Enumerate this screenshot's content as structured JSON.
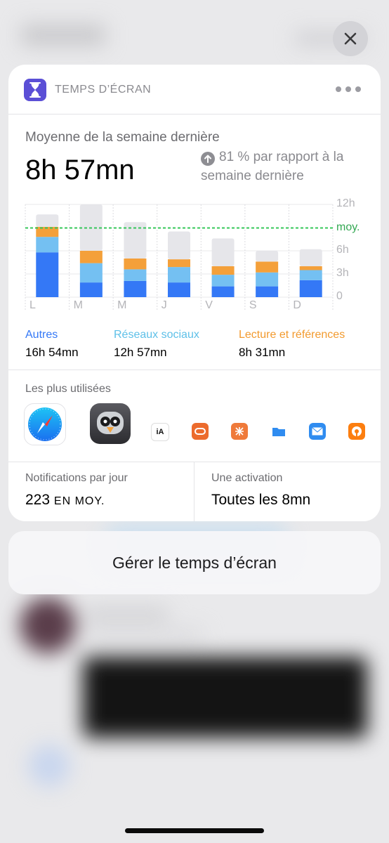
{
  "widget": {
    "app_title": "TEMPS D’ÉCRAN",
    "app_icon": "hourglass-icon",
    "more_icon": "ellipsis-icon",
    "average_label": "Moyenne de la semaine dernière",
    "average_value": "8h 57mn",
    "comparison_text": "81 % par rapport à la semaine dernière",
    "comparison_icon": "arrow-up-circle-icon"
  },
  "chart_data": {
    "type": "bar",
    "stacked": true,
    "categories": [
      "L",
      "M",
      "M",
      "J",
      "V",
      "S",
      "D"
    ],
    "y_ticks": [
      "12h",
      "moy.",
      "6h",
      "3h",
      "0"
    ],
    "ylim": [
      0,
      12
    ],
    "average_hours": 8.95,
    "series": [
      {
        "name": "Autres",
        "color": "#3478f6",
        "values": [
          5.8,
          1.9,
          2.1,
          1.9,
          1.4,
          1.4,
          2.2
        ]
      },
      {
        "name": "Réseaux sociaux",
        "color": "#74c0f2",
        "values": [
          2.0,
          2.5,
          1.5,
          2.0,
          1.5,
          1.8,
          1.3
        ]
      },
      {
        "name": "Lecture et références",
        "color": "#f4a03a",
        "values": [
          1.3,
          1.6,
          1.4,
          1.0,
          1.1,
          1.4,
          0.5
        ]
      },
      {
        "color": "#e6e6ea",
        "values": [
          1.6,
          6.0,
          4.7,
          3.6,
          3.6,
          1.4,
          2.2
        ]
      }
    ],
    "grid": true
  },
  "legend": [
    {
      "name": "Autres",
      "value": "16h 54mn",
      "color": "#3478f6"
    },
    {
      "name": "Réseaux sociaux",
      "value": "12h 57mn",
      "color": "#5ec0e8"
    },
    {
      "name": "Lecture et références",
      "value": "8h 31mn",
      "color": "#f29a2e"
    }
  ],
  "most_used": {
    "label": "Les plus utilisées",
    "apps": [
      "safari-icon",
      "tweetbot-icon",
      "ia-writer-icon",
      "app-orange-icon",
      "app-orange-grid-icon",
      "files-icon",
      "mail-icon",
      "overcast-icon"
    ]
  },
  "stats": {
    "notifications_label": "Notifications par jour",
    "notifications_value": "223",
    "notifications_unit": "EN MOY.",
    "activation_label": "Une activation",
    "activation_value": "Toutes les 8mn"
  },
  "manage_button": "Gérer le temps d’écran",
  "close_icon": "close-icon"
}
